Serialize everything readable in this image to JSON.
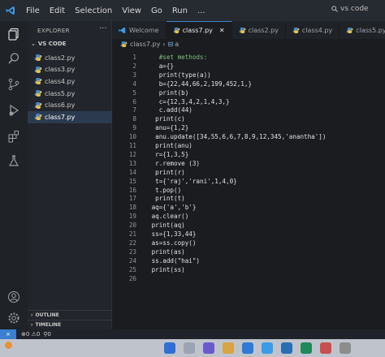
{
  "menu": [
    "File",
    "Edit",
    "Selection",
    "View",
    "Go",
    "Run",
    "..."
  ],
  "search": {
    "label": "vs code"
  },
  "sidebar": {
    "title": "EXPLORER",
    "folder": "VS CODE",
    "files": [
      "class2.py",
      "class3.py",
      "class4.py",
      "class5.py",
      "class6.py",
      "class7.py"
    ],
    "active_file": "class7.py",
    "outline": "OUTLINE",
    "timeline": "TIMELINE"
  },
  "tabs": [
    "Welcome",
    "class7.py",
    "class2.py",
    "class4.py",
    "class5.py"
  ],
  "active_tab": "class7.py",
  "breadcrumb": {
    "file": "class7.py",
    "symbol": "a"
  },
  "editor": {
    "lines": [
      {
        "n": "1",
        "text": "   #set methods:"
      },
      {
        "n": "2",
        "text": "   a={}"
      },
      {
        "n": "3",
        "text": "   print(type(a))"
      },
      {
        "n": "4",
        "text": "   b={22,44,66,2,199,452,1,}"
      },
      {
        "n": "5",
        "text": "   print(b)"
      },
      {
        "n": "6",
        "text": "   c={12,3,4,2,1,4,3,}"
      },
      {
        "n": "7",
        "text": "   c.add(44)"
      },
      {
        "n": "8",
        "text": "  print(c)"
      },
      {
        "n": "9",
        "text": "  anu={1,2}"
      },
      {
        "n": "10",
        "text": "  anu.update([34,55,6,6,7,8,9,12,345,'anantha'])"
      },
      {
        "n": "11",
        "text": "  print(anu)"
      },
      {
        "n": "12",
        "text": "  r={1,3,5}"
      },
      {
        "n": "13",
        "text": "  r.remove (3)"
      },
      {
        "n": "14",
        "text": "  print(r)"
      },
      {
        "n": "15",
        "text": "  t={'raj','rani',1,4,0}"
      },
      {
        "n": "16",
        "text": "  t.pop()"
      },
      {
        "n": "17",
        "text": "  print(t)"
      },
      {
        "n": "18",
        "text": " aq={'a','b'}"
      },
      {
        "n": "19",
        "text": " aq.clear()"
      },
      {
        "n": "20",
        "text": " print(aq)"
      },
      {
        "n": "21",
        "text": " ss={1,33,44}"
      },
      {
        "n": "22",
        "text": " as=ss.copy()"
      },
      {
        "n": "23",
        "text": " print(as)"
      },
      {
        "n": "24",
        "text": " ss.add(\"hai\")"
      },
      {
        "n": "25",
        "text": " print(ss)"
      },
      {
        "n": "26",
        "text": ""
      }
    ]
  },
  "status": {
    "remote": "⨯",
    "problems": "⊗0 ⚠0",
    "ports": "⚲0"
  },
  "colors": {
    "accent": "#3a7fd0",
    "editor_bg": "#1a1c20",
    "sidebar_bg": "#22252b",
    "active_row": "#2c3a4f"
  }
}
